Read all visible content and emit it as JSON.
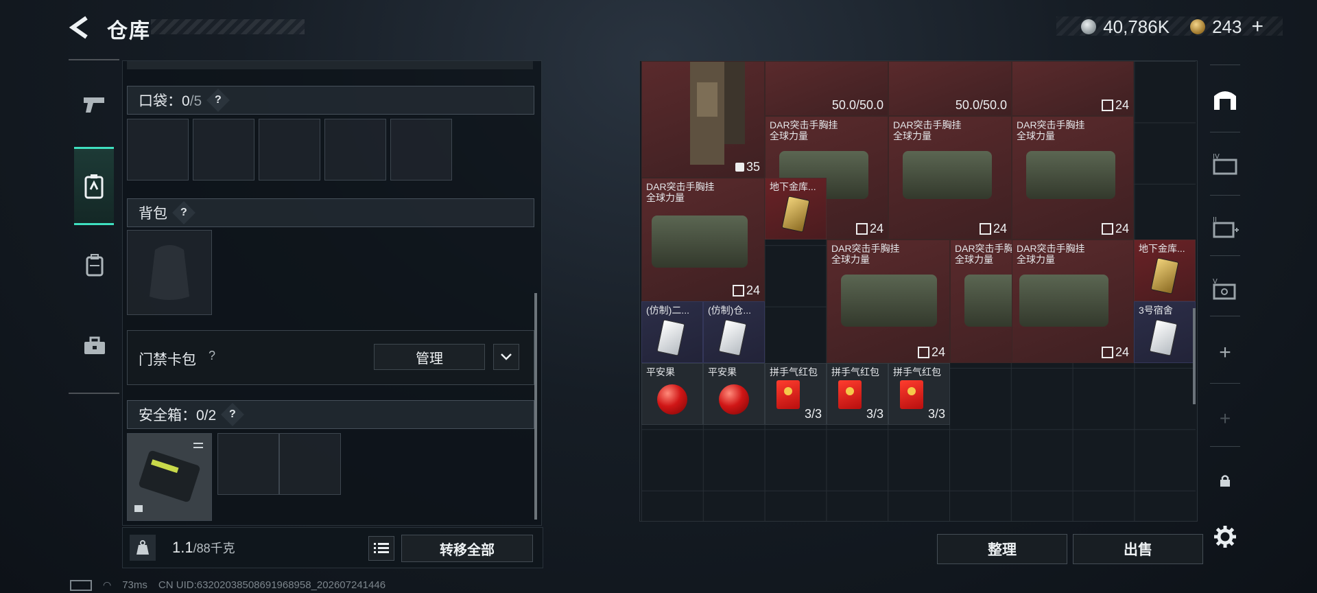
{
  "header": {
    "title": "仓库"
  },
  "currency": {
    "silver": "40,786K",
    "gold": "243",
    "add_label": "+"
  },
  "loadout": {
    "pocket": {
      "label": "口袋：",
      "count": "0",
      "max": "/5",
      "help": "?"
    },
    "backpack": {
      "label": "背包",
      "help": "?"
    },
    "card_pack": {
      "label": "门禁卡包",
      "help": "?",
      "manage_label": "管理"
    },
    "safebox": {
      "label": "安全箱：0/2",
      "help": "?"
    },
    "weight": {
      "current": "1.1",
      "max": "/88千克"
    },
    "transfer_label": "转移全部"
  },
  "status": {
    "ping": "73ms",
    "uid": "CN UID:63202038508691968958_202607241446"
  },
  "storage": {
    "items": [
      {
        "name": "",
        "count": "35"
      },
      {
        "name": "",
        "count": "50.0/50.0"
      },
      {
        "name": "",
        "count": "50.0/50.0"
      },
      {
        "name": "",
        "count": "24"
      },
      {
        "name": "DAR突击手胸挂\n全球力量",
        "count": "24"
      },
      {
        "name": "DAR突击手胸挂\n全球力量",
        "count": "24"
      },
      {
        "name": "DAR突击手胸挂\n全球力量",
        "count": "24"
      },
      {
        "name": "DAR突击手胸挂\n全球力量",
        "count": "24"
      },
      {
        "name": "地下金库...",
        "count": ""
      },
      {
        "name": "DAR突击手胸挂\n全球力量",
        "count": "24"
      },
      {
        "name": "DAR突击手胸挂\n全球力量",
        "count": "24"
      },
      {
        "name": "DAR突击手胸挂\n全球力量",
        "count": "24"
      },
      {
        "name": "地下金库...",
        "count": ""
      },
      {
        "name": "(仿制)二...",
        "count": ""
      },
      {
        "name": "(仿制)仓...",
        "count": ""
      },
      {
        "name": "3号宿舍",
        "count": ""
      },
      {
        "name": "平安果",
        "count": ""
      },
      {
        "name": "平安果",
        "count": ""
      },
      {
        "name": "拼手气红包",
        "count": "3/3"
      },
      {
        "name": "拼手气红包",
        "count": "3/3"
      },
      {
        "name": "拼手气红包",
        "count": "3/3"
      }
    ]
  },
  "actions": {
    "sort_label": "整理",
    "sell_label": "出售"
  },
  "colors": {
    "accent": "#3fe0c0",
    "rare_red": "#5a2a2c",
    "purple": "#2c2e48"
  },
  "icons": [
    "back-arrow-icon",
    "silver-coin-icon",
    "gold-coin-icon",
    "pistol-icon",
    "card-badge-icon",
    "backpack-icon",
    "toolbox-icon",
    "weight-icon",
    "list-icon",
    "warehouse-icon",
    "lock-icon",
    "settings-icon"
  ]
}
